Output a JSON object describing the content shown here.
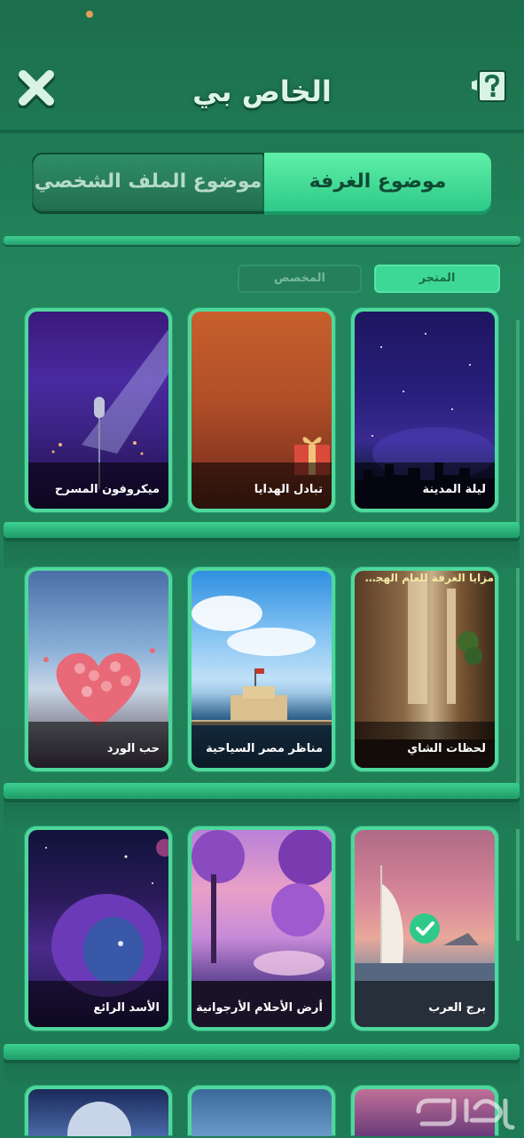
{
  "header": {
    "title": "الخاص بي",
    "help_icon": "question-icon",
    "close_icon": "close-x-icon"
  },
  "tabs": {
    "room_theme": "موضوع الغرفة",
    "profile_theme": "موضوع الملف الشخصي",
    "active": "room_theme"
  },
  "subtabs": {
    "store": "المتجر",
    "owned": "المخصص",
    "active": "store"
  },
  "themes": [
    {
      "name": "ليلة المدينة"
    },
    {
      "name": "تبادل الهدايا"
    },
    {
      "name": "ميكروفون المسرح"
    },
    {
      "name": "لحظات الشاي",
      "extra": "مزايا الغرفة للعام الهجري..."
    },
    {
      "name": "مناظر مصر السياحية"
    },
    {
      "name": "حب الورد"
    },
    {
      "name": "برج العرب",
      "selected": true
    },
    {
      "name": "أرض الأحلام الأرجوانية"
    },
    {
      "name": "الأسد الرائع"
    }
  ],
  "watermark": {
    "text": "حراج"
  },
  "colors": {
    "accent": "#3ed896",
    "background": "#1e7a55",
    "card_border": "#4ed89c"
  }
}
